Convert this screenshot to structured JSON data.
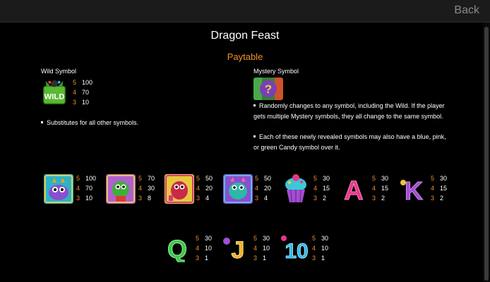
{
  "header": {
    "back_label": "Back"
  },
  "title": "Dragon Feast",
  "subtitle": "Paytable",
  "wild": {
    "label": "Wild Symbol",
    "pays": [
      {
        "n": "5",
        "v": "100"
      },
      {
        "n": "4",
        "v": "70"
      },
      {
        "n": "3",
        "v": "10"
      }
    ],
    "bullets": [
      "Substitutes for all other symbols."
    ]
  },
  "mystery": {
    "label": "Mystery Symbol",
    "bullets": [
      "Randomly changes to any symbol, including the Wild. If the player gets multiple Mystery symbols, they all change to the same symbol.",
      "Each of these newly revealed symbols may also have a blue, pink, or green Candy symbol over it."
    ]
  },
  "row1": [
    {
      "name": "dragon-purple",
      "pays": [
        {
          "n": "5",
          "v": "100"
        },
        {
          "n": "4",
          "v": "70"
        },
        {
          "n": "3",
          "v": "10"
        }
      ]
    },
    {
      "name": "dragon-green",
      "pays": [
        {
          "n": "5",
          "v": "70"
        },
        {
          "n": "4",
          "v": "30"
        },
        {
          "n": "3",
          "v": "8"
        }
      ]
    },
    {
      "name": "dragon-red",
      "pays": [
        {
          "n": "5",
          "v": "50"
        },
        {
          "n": "4",
          "v": "20"
        },
        {
          "n": "3",
          "v": "4"
        }
      ]
    },
    {
      "name": "dragon-teal",
      "pays": [
        {
          "n": "5",
          "v": "50"
        },
        {
          "n": "4",
          "v": "20"
        },
        {
          "n": "3",
          "v": "4"
        }
      ]
    },
    {
      "name": "cupcake",
      "pays": [
        {
          "n": "5",
          "v": "30"
        },
        {
          "n": "4",
          "v": "15"
        },
        {
          "n": "3",
          "v": "2"
        }
      ]
    },
    {
      "name": "letter-a",
      "pays": [
        {
          "n": "5",
          "v": "30"
        },
        {
          "n": "4",
          "v": "15"
        },
        {
          "n": "3",
          "v": "2"
        }
      ]
    },
    {
      "name": "letter-k",
      "pays": [
        {
          "n": "5",
          "v": "30"
        },
        {
          "n": "4",
          "v": "15"
        },
        {
          "n": "3",
          "v": "2"
        }
      ]
    }
  ],
  "row2": [
    {
      "name": "letter-q",
      "pays": [
        {
          "n": "5",
          "v": "30"
        },
        {
          "n": "4",
          "v": "10"
        },
        {
          "n": "3",
          "v": "1"
        }
      ]
    },
    {
      "name": "letter-j",
      "pays": [
        {
          "n": "5",
          "v": "30"
        },
        {
          "n": "4",
          "v": "10"
        },
        {
          "n": "3",
          "v": "1"
        }
      ]
    },
    {
      "name": "number-10",
      "pays": [
        {
          "n": "5",
          "v": "30"
        },
        {
          "n": "4",
          "v": "10"
        },
        {
          "n": "3",
          "v": "1"
        }
      ]
    }
  ],
  "colors": {
    "accent": "#f0902a",
    "background": "#000000",
    "topbar": "#1b1b1b"
  }
}
